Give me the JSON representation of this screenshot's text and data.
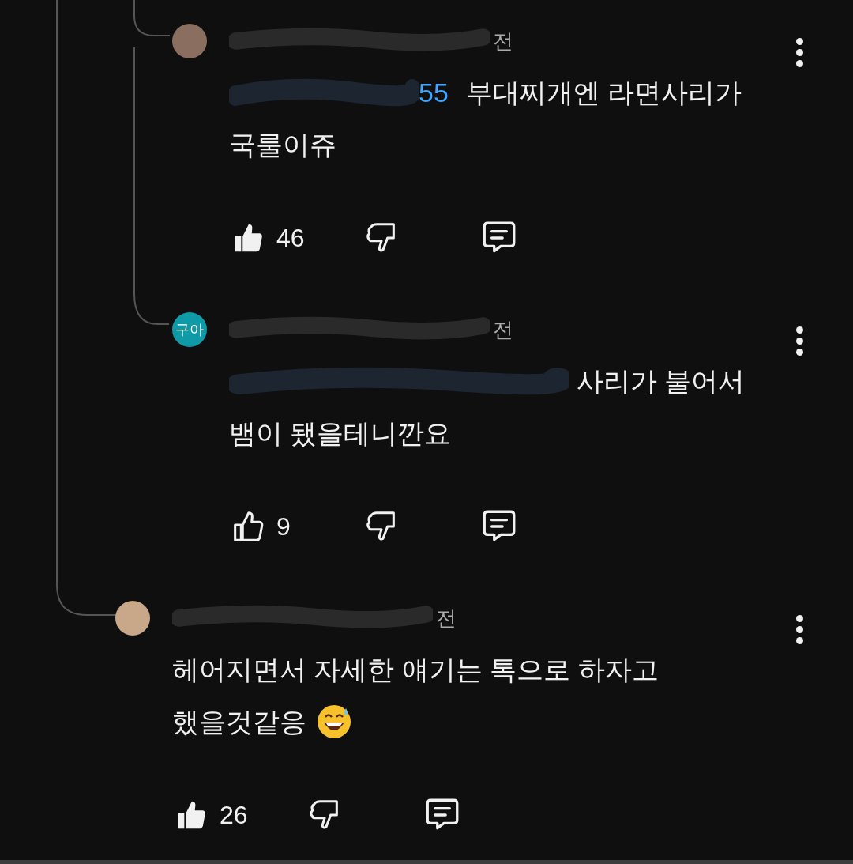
{
  "comments": [
    {
      "kind": "plain",
      "reply": true,
      "avatar": {
        "kind": "photo",
        "color": "#8a6e60"
      },
      "header": "전",
      "mention": "55",
      "lines": [
        "부대찌개엔 라면사리가",
        "국룰이쥬"
      ],
      "liked": true,
      "likes": "46"
    },
    {
      "kind": "plain",
      "reply": true,
      "avatar": {
        "kind": "initials",
        "text": "구아",
        "color": "#0f9aa8"
      },
      "header": "전",
      "lines": [
        "사리가 불어서",
        "뱀이 됐을테니깐요"
      ],
      "liked": false,
      "likes": "9"
    },
    {
      "kind": "emoji",
      "reply": false,
      "avatar": {
        "kind": "photo",
        "color": "#c8a888"
      },
      "header": "전",
      "lines": [
        "헤어지면서 자세한 얘기는 톡으로 하자고",
        "했을것같응"
      ],
      "liked": true,
      "likes": "26"
    }
  ]
}
